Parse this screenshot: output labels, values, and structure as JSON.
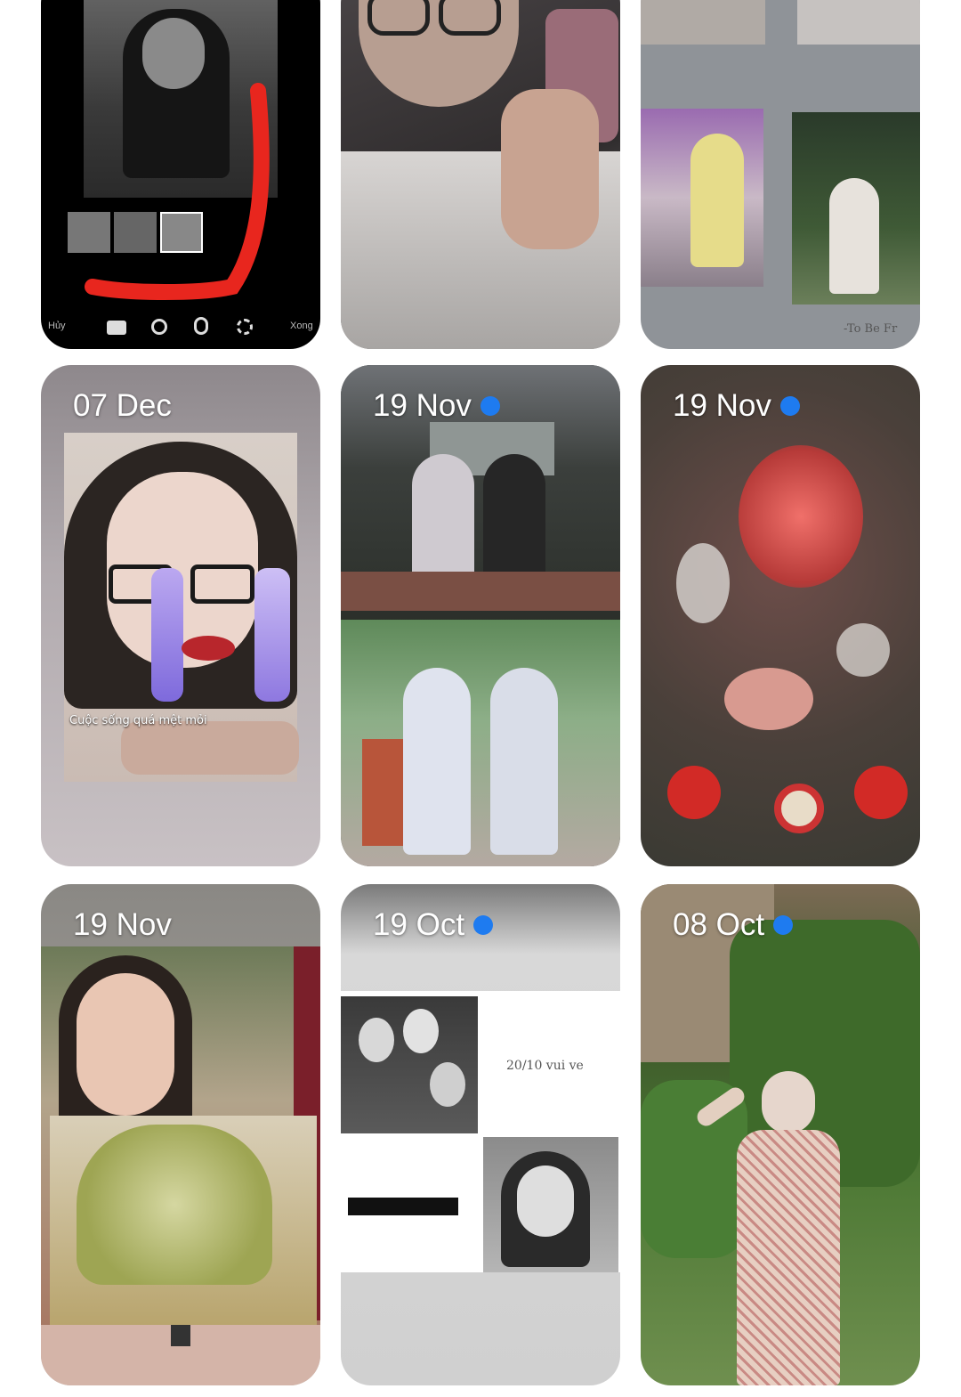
{
  "stories": [
    {
      "id": "story-1",
      "date": "",
      "unread": false,
      "toolbar": {
        "left_label": "Hủy",
        "right_label": "Xong"
      }
    },
    {
      "id": "story-2",
      "date": "",
      "unread": false
    },
    {
      "id": "story-3",
      "date": "",
      "unread": false,
      "caption": "-To Be Fr"
    },
    {
      "id": "story-4",
      "date": "07 Dec",
      "unread": false,
      "caption": "Cuộc sống quá mệt mỏi"
    },
    {
      "id": "story-5",
      "date": "19 Nov",
      "unread": true
    },
    {
      "id": "story-6",
      "date": "19 Nov",
      "unread": true
    },
    {
      "id": "story-7",
      "date": "19 Nov",
      "unread": false
    },
    {
      "id": "story-8",
      "date": "19 Oct",
      "unread": true,
      "caption": "20/10 vui ve"
    },
    {
      "id": "story-9",
      "date": "08 Oct",
      "unread": true
    }
  ],
  "colors": {
    "unread_dot": "#1e7bf0",
    "highlight_stroke": "#e8261e"
  },
  "icons": [
    "video-icon",
    "brightness-icon",
    "filter-icon",
    "adjust-icon"
  ]
}
